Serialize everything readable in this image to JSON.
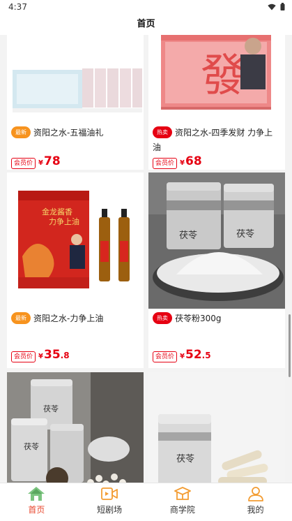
{
  "status_bar": {
    "time": "4:37"
  },
  "header": {
    "title": "首页"
  },
  "products": [
    {
      "name": "资阳之水-五福油礼",
      "tag": "最新",
      "tag_color": "#f7931e",
      "member_label": "会员价",
      "currency": "¥",
      "price_int": "78",
      "price_dec": ""
    },
    {
      "name": "资阳之水-四季发财 力争上油",
      "tag": "热卖",
      "tag_color": "#e60012",
      "member_label": "会员价",
      "currency": "¥",
      "price_int": "68",
      "price_dec": ""
    },
    {
      "name": "资阳之水-力争上油",
      "tag": "最新",
      "tag_color": "#f7931e",
      "member_label": "会员价",
      "currency": "¥",
      "price_int": "35",
      "price_dec": ".8"
    },
    {
      "name": "茯苓粉300g",
      "tag": "热卖",
      "tag_color": "#e60012",
      "member_label": "会员价",
      "currency": "¥",
      "price_int": "52",
      "price_dec": ".5"
    },
    {
      "name": "",
      "tag": "",
      "member_label": "",
      "currency": "",
      "price_int": "",
      "price_dec": ""
    },
    {
      "name": "",
      "tag": "",
      "member_label": "",
      "currency": "",
      "price_int": "",
      "price_dec": ""
    }
  ],
  "image_text": {
    "fa_char": "發",
    "box_brand": "金龙酱香",
    "box_slogan": "力争上油",
    "jar_label": "茯苓",
    "jar_label_vertical": "茯\n苓"
  },
  "tabbar": {
    "items": [
      {
        "label": "首页",
        "icon": "home-icon",
        "active": true
      },
      {
        "label": "短剧场",
        "icon": "video-icon",
        "active": false
      },
      {
        "label": "商学院",
        "icon": "school-icon",
        "active": false
      },
      {
        "label": "我的",
        "icon": "user-icon",
        "active": false
      }
    ],
    "active_color": "#e8462c",
    "icon_color": "#f39c32"
  }
}
